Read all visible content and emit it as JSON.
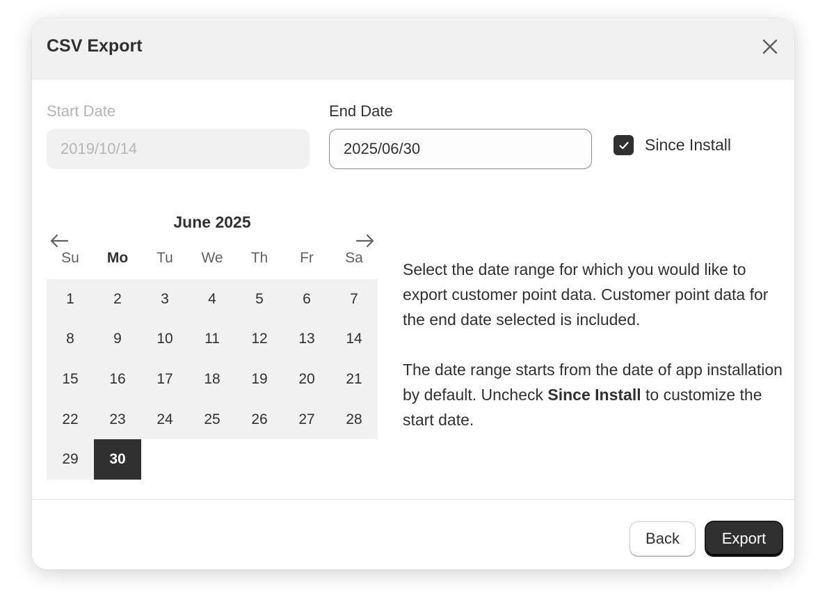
{
  "modal": {
    "title": "CSV Export"
  },
  "start_date": {
    "label": "Start Date",
    "value": "2019/10/14",
    "disabled": true
  },
  "end_date": {
    "label": "End Date",
    "value": "2025/06/30"
  },
  "since_install": {
    "label": "Since Install",
    "checked": true
  },
  "calendar": {
    "title": "June 2025",
    "weekdays": [
      "Su",
      "Mo",
      "Tu",
      "We",
      "Th",
      "Fr",
      "Sa"
    ],
    "current_weekday": "Mo",
    "days": [
      "1",
      "2",
      "3",
      "4",
      "5",
      "6",
      "7",
      "8",
      "9",
      "10",
      "11",
      "12",
      "13",
      "14",
      "15",
      "16",
      "17",
      "18",
      "19",
      "20",
      "21",
      "22",
      "23",
      "24",
      "25",
      "26",
      "27",
      "28",
      "29",
      "30"
    ],
    "selected_day": "30"
  },
  "description": {
    "paragraph1": "Select the date range for which you would like to export customer point data. Customer point data for the end date selected is included.",
    "paragraph2_before": "The date range starts from the date of app installation by default. Uncheck ",
    "paragraph2_bold": "Since Install",
    "paragraph2_after": " to customize the start date."
  },
  "footer": {
    "back_label": "Back",
    "export_label": "Export"
  },
  "colors": {
    "primary": "#303030",
    "surface_muted": "#f1f1f1",
    "disabled_text": "#b5b5b5"
  }
}
